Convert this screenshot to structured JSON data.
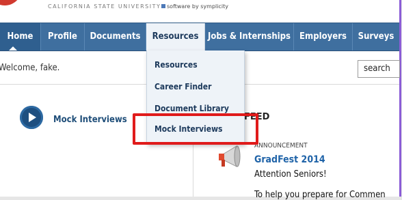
{
  "header": {
    "university": "CALIFORNIA STATE UNIVERSITY",
    "powered_by": "software by symplicity"
  },
  "nav": {
    "items": [
      {
        "label": "Home"
      },
      {
        "label": "Profile"
      },
      {
        "label": "Documents"
      },
      {
        "label": "Resources"
      },
      {
        "label": "Jobs & Internships"
      },
      {
        "label": "Employers"
      },
      {
        "label": "Surveys"
      }
    ]
  },
  "dropdown": {
    "items": [
      {
        "label": "Resources"
      },
      {
        "label": "Career Finder"
      },
      {
        "label": "Document Library"
      },
      {
        "label": "Mock Interviews"
      }
    ]
  },
  "welcome": "Welcome, fake.",
  "search": {
    "label": "search"
  },
  "left_panel": {
    "item_label": "Mock Interviews"
  },
  "feed": {
    "title": "FEED",
    "tag": "ANNOUNCEMENT",
    "post_title": "GradFest 2014",
    "post_line1": "Attention Seniors!",
    "post_line2": "To help you prepare for Commen"
  },
  "colors": {
    "nav_blue": "#3f6f9f",
    "highlight_red": "#e01b1b",
    "link_blue": "#1f63a8"
  }
}
